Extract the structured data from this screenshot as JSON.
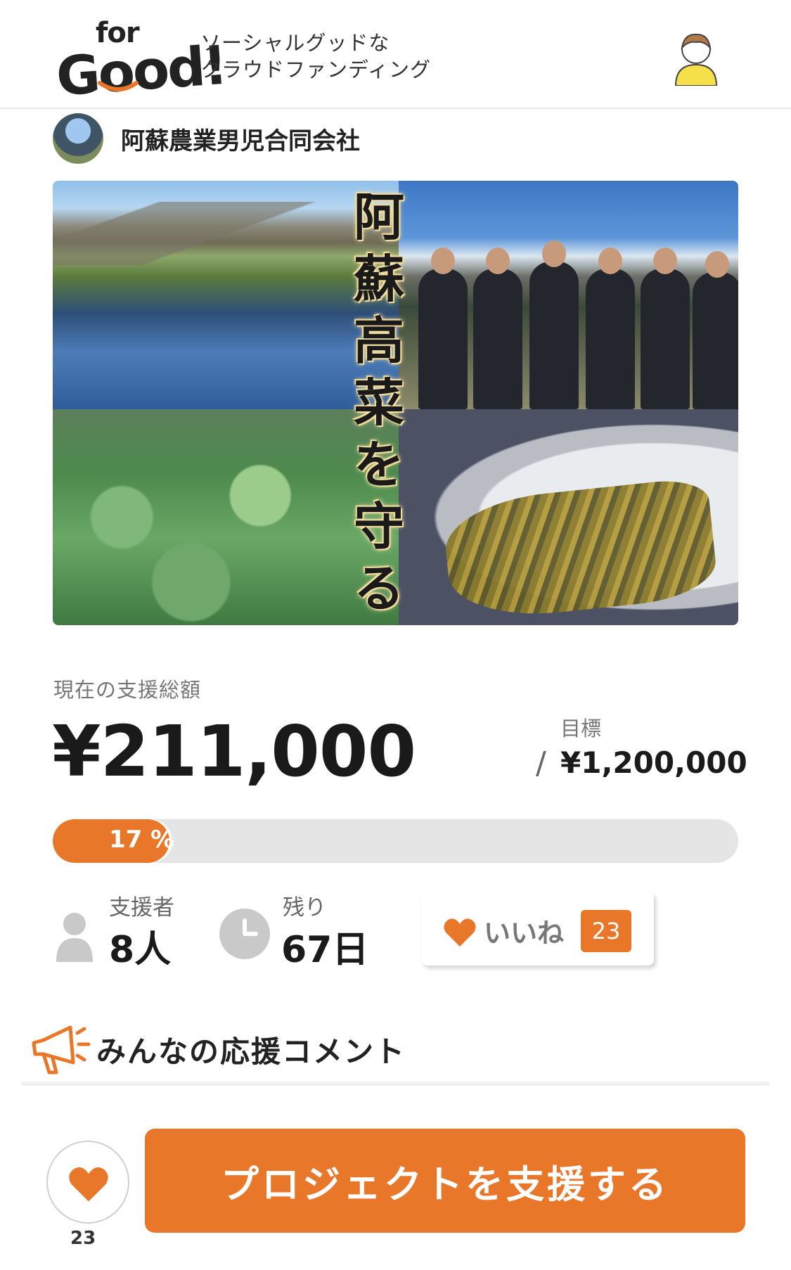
{
  "header": {
    "logo_for": "for",
    "logo_good": "Good!",
    "tagline_line1": "ソーシャルグッドな",
    "tagline_line2": "クラウドファンディング",
    "user_icon": "user-avatar-icon"
  },
  "organizer": {
    "name": "阿蘇農業男児合同会社"
  },
  "hero": {
    "title_vertical": "阿蘇高菜を守る"
  },
  "funding": {
    "current_label": "現在の支援総額",
    "current_amount": "¥211,000",
    "goal_label": "目標",
    "goal_slash": "/",
    "goal_amount": "¥1,200,000",
    "progress_text": "17 %",
    "progress_value": 0.17
  },
  "stats": {
    "supporters_label": "支援者",
    "supporters_value": "8人",
    "remaining_label": "残り",
    "remaining_value": "67日"
  },
  "like": {
    "label": "いいね",
    "count": "23"
  },
  "comments": {
    "title": "みんなの応援コメント"
  },
  "bottom_bar": {
    "favorite_count": "23",
    "support_button": "プロジェクトを支援する"
  },
  "colors": {
    "accent": "#e9772a",
    "progress_track": "#e5e5e5",
    "muted_text": "#777777"
  }
}
